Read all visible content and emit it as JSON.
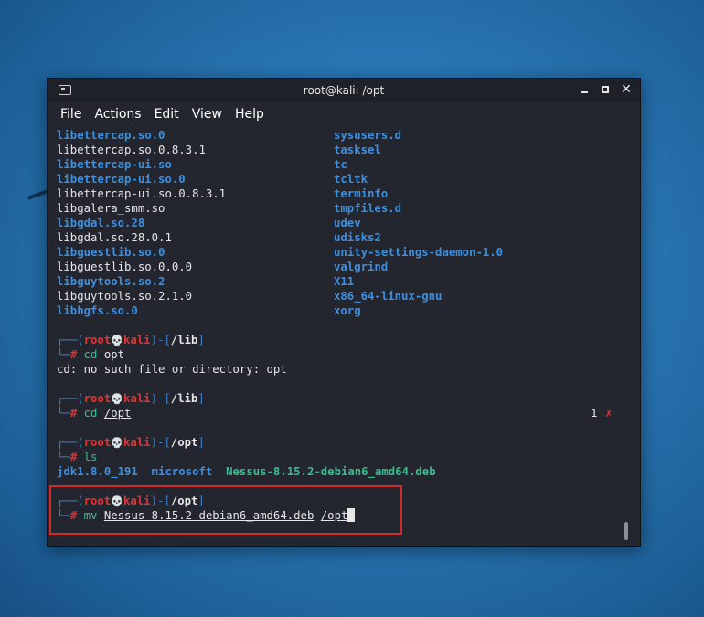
{
  "window": {
    "title": "root@kali: /opt"
  },
  "menu": [
    "File",
    "Actions",
    "Edit",
    "View",
    "Help"
  ],
  "listing": [
    {
      "l": "libettercap.so.0",
      "lb": true,
      "r": "sysusers.d"
    },
    {
      "l": "libettercap.so.0.8.3.1",
      "lb": false,
      "r": "tasksel"
    },
    {
      "l": "libettercap-ui.so",
      "lb": true,
      "r": "tc"
    },
    {
      "l": "libettercap-ui.so.0",
      "lb": true,
      "r": "tcltk"
    },
    {
      "l": "libettercap-ui.so.0.8.3.1",
      "lb": false,
      "r": "terminfo"
    },
    {
      "l": "libgalera_smm.so",
      "lb": false,
      "r": "tmpfiles.d"
    },
    {
      "l": "libgdal.so.28",
      "lb": true,
      "r": "udev"
    },
    {
      "l": "libgdal.so.28.0.1",
      "lb": false,
      "r": "udisks2"
    },
    {
      "l": "libguestlib.so.0",
      "lb": true,
      "r": "unity-settings-daemon-1.0"
    },
    {
      "l": "libguestlib.so.0.0.0",
      "lb": false,
      "r": "valgrind"
    },
    {
      "l": "libguytools.so.2",
      "lb": true,
      "r": "X11"
    },
    {
      "l": "libguytools.so.2.1.0",
      "lb": false,
      "r": "x86_64-linux-gnu"
    },
    {
      "l": "libhgfs.so.0",
      "lb": true,
      "r": "xorg"
    }
  ],
  "prompt": {
    "user": "root",
    "host": "kali",
    "top_left": "┌──(",
    "mid": ")-[",
    "close": "]",
    "bottom": "└─",
    "hash": "#"
  },
  "blocks": [
    {
      "dir": "/lib",
      "cmd": "cd",
      "arg": "opt",
      "output": "cd: no such file or directory: opt"
    },
    {
      "dir": "/lib",
      "cmd": "cd",
      "arg": "/opt",
      "exit_code": "1",
      "exit_mark": "✗"
    },
    {
      "dir": "/opt",
      "cmd": "ls",
      "ls_items": [
        "jdk1.8.0_191",
        "microsoft",
        "Nessus-8.15.2-debian6_amd64.deb"
      ]
    },
    {
      "dir": "/opt",
      "cmd": "mv",
      "arg1": "Nessus-8.15.2-debian6_amd64.deb",
      "arg2": "/opt"
    }
  ],
  "colors": {
    "dir_blue": "#3d8fe0",
    "prompt_red": "#e23333",
    "cmd_green": "#3dbb8f",
    "highlight_box": "#d42a2a",
    "terminal_bg": "#23262e"
  }
}
